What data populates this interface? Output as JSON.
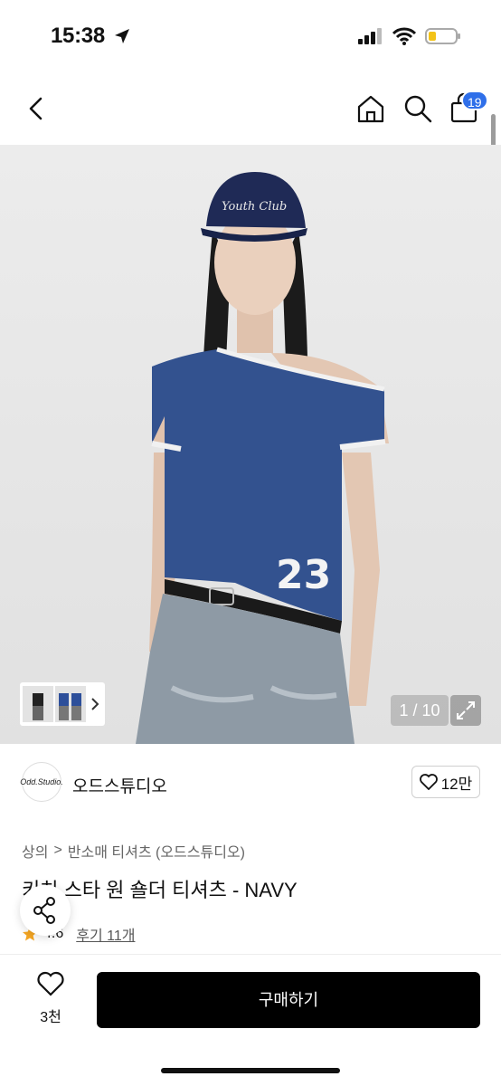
{
  "status_bar": {
    "time": "15:38"
  },
  "header": {
    "cart_count": "19"
  },
  "gallery": {
    "counter": "1 / 10"
  },
  "brand": {
    "logo_text": "Odd.Studio.",
    "name": "오드스튜디오",
    "like_count": "12만"
  },
  "breadcrumb": {
    "level1": "상의",
    "separator": ">",
    "level2": "반소매 티셔츠 (오드스튜디오)"
  },
  "product": {
    "title": "키치 스타 원 숄더 티셔츠 - NAVY",
    "rating": "4.6",
    "review_link": "후기 11개",
    "image": {
      "cap_text": "Youth Club",
      "jersey_number": "23"
    }
  },
  "bottom_bar": {
    "wish_count": "3천",
    "buy_label": "구매하기"
  },
  "colors": {
    "accent": "#2f6fe9",
    "shirt": "#33528f",
    "rating_star": "#f5a623"
  }
}
